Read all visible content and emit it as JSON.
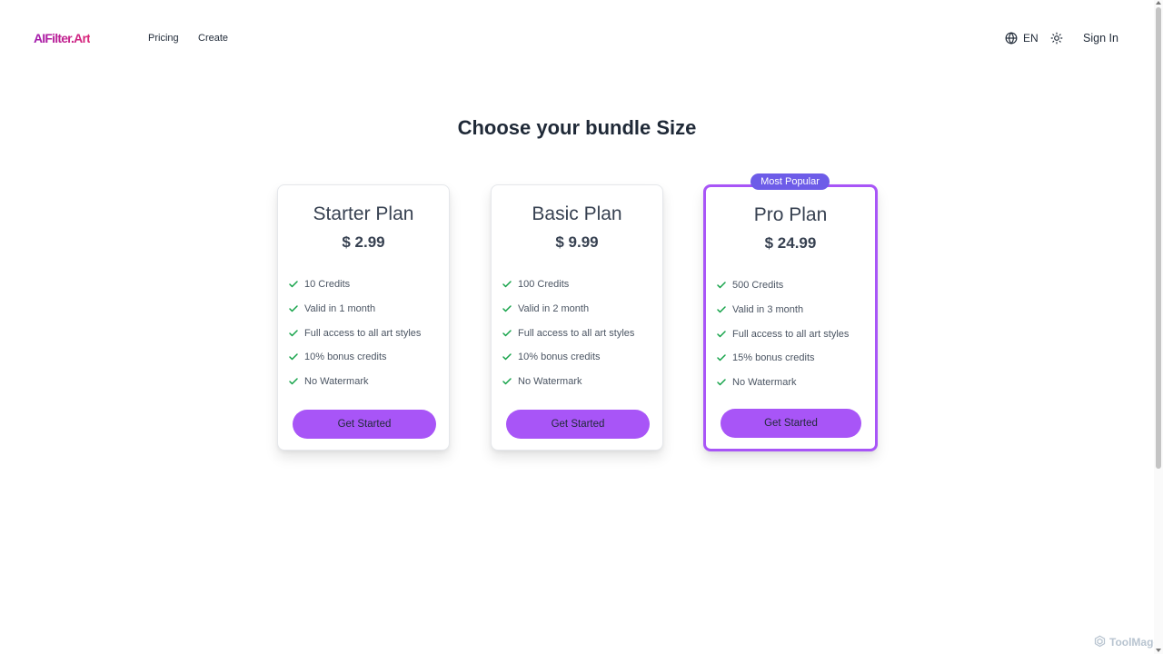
{
  "header": {
    "logo": "AIFilter.Art",
    "nav": [
      {
        "label": "Pricing"
      },
      {
        "label": "Create"
      }
    ],
    "language": "EN",
    "sign_in": "Sign In"
  },
  "page_title": "Choose your bundle Size",
  "badge": "Most Popular",
  "plans": [
    {
      "name": "Starter Plan",
      "price": "$ 2.99",
      "features": [
        "10 Credits",
        "Valid in 1 month",
        "Full access to all art styles",
        "10% bonus credits",
        "No Watermark"
      ],
      "cta": "Get Started"
    },
    {
      "name": "Basic Plan",
      "price": "$ 9.99",
      "features": [
        "100 Credits",
        "Valid in 2 month",
        "Full access to all art styles",
        "10% bonus credits",
        "No Watermark"
      ],
      "cta": "Get Started"
    },
    {
      "name": "Pro Plan",
      "price": "$ 24.99",
      "features": [
        "500 Credits",
        "Valid in 3 month",
        "Full access to all art styles",
        "15% bonus credits",
        "No Watermark"
      ],
      "cta": "Get Started"
    }
  ],
  "watermark": "ToolMage",
  "colors": {
    "accent": "#a855f7",
    "badge": "#6d5ce8",
    "check": "#16a34a",
    "logo": "#c026d3"
  },
  "icons": {
    "language": "globe-icon",
    "theme": "sun-icon",
    "feature": "check-icon"
  }
}
